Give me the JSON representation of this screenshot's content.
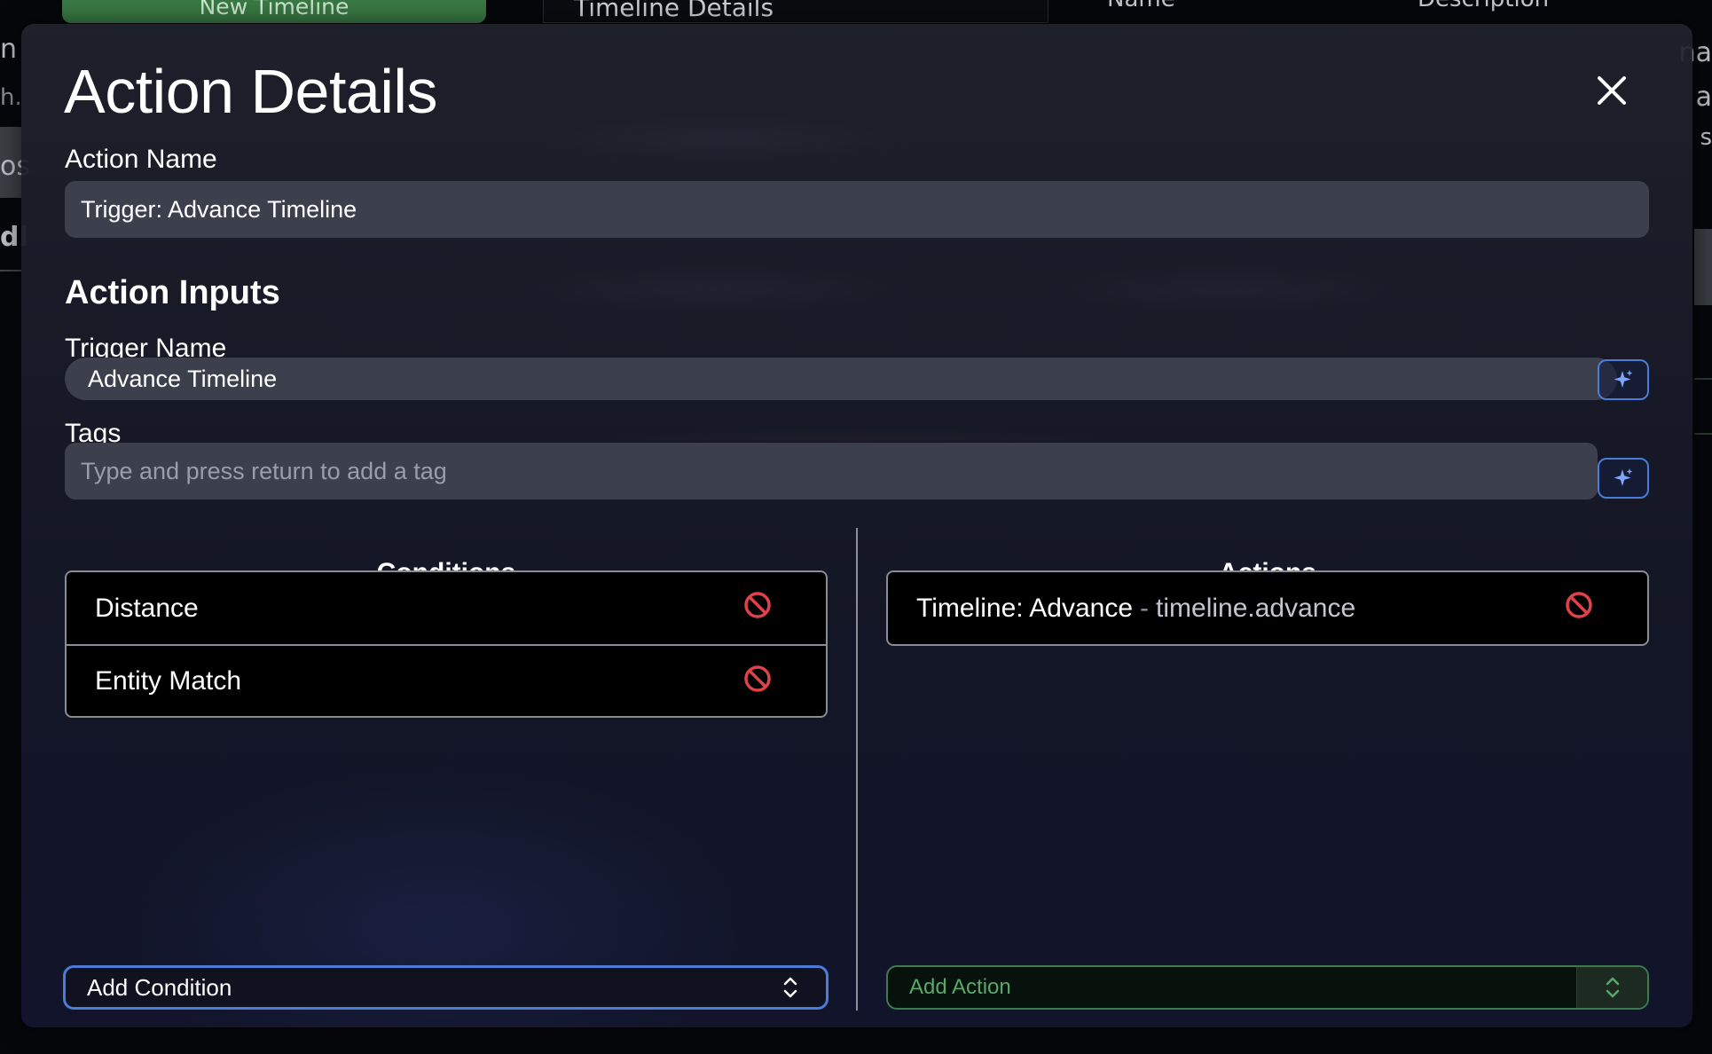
{
  "background": {
    "new_timeline_label": "New Timeline",
    "timeline_details_label": "Timeline Details",
    "step_name_header": "Step Name",
    "description_header": "Description",
    "left_fragments": [
      "n",
      "h.",
      "os",
      "dl"
    ],
    "right_fragments": [
      "na",
      "a",
      "s"
    ]
  },
  "modal": {
    "title": "Action Details",
    "close_icon": "close-icon",
    "action_name_label": "Action Name",
    "action_name_value": "Trigger: Advance Timeline",
    "action_inputs_title": "Action Inputs",
    "trigger_name_label": "Trigger Name",
    "trigger_name_value": "Advance Timeline",
    "tags_label": "Tags",
    "tags_placeholder": "Type and press return to add a tag",
    "sparkle_icon": "sparkle-icon",
    "conditions": {
      "heading": "Conditions",
      "items": [
        {
          "label": "Distance"
        },
        {
          "label": "Entity Match"
        }
      ],
      "add_label": "Add Condition"
    },
    "actions": {
      "heading": "Actions",
      "items": [
        {
          "label": "Timeline: Advance",
          "separator": "-",
          "id": "timeline.advance"
        }
      ],
      "add_label": "Add Action"
    }
  },
  "colors": {
    "accent_blue": "#4d7bd8",
    "remove_red": "#e0424a",
    "add_action_green": "#57a86b",
    "field_bg": "#3c3f4c"
  }
}
